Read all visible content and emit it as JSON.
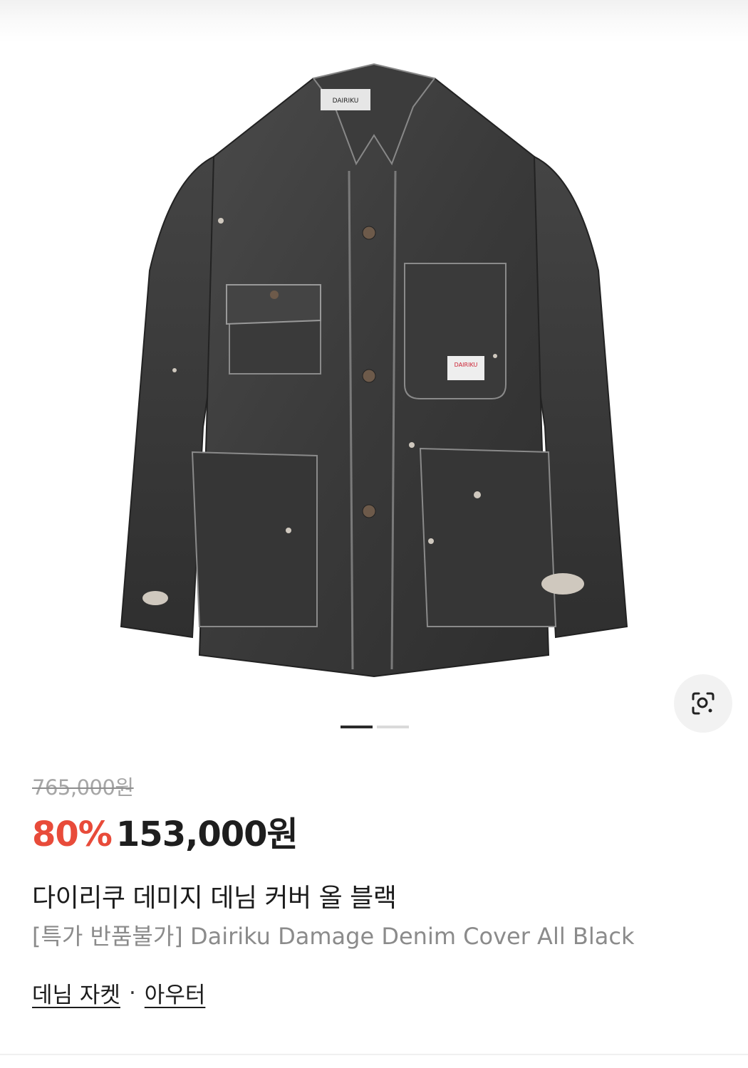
{
  "gallery": {
    "image_alt": "Dairiku Damage Denim Cover All Black",
    "slide_count": 2,
    "active_slide": 1
  },
  "lens": {
    "icon": "lens-search-icon"
  },
  "product": {
    "original_price": "765,000원",
    "discount": "80%",
    "sale_price": "153,000원",
    "title_ko": "다이리쿠 데미지 데님 커버 올 블랙",
    "title_en": "[특가 반품불가] Dairiku Damage Denim Cover All Black"
  },
  "categories": {
    "primary": "데님 자켓",
    "separator": "·",
    "secondary": "아우터"
  },
  "colors": {
    "discount": "#e84b3a",
    "price": "#1e1e1e",
    "muted": "#8b8b8b"
  }
}
